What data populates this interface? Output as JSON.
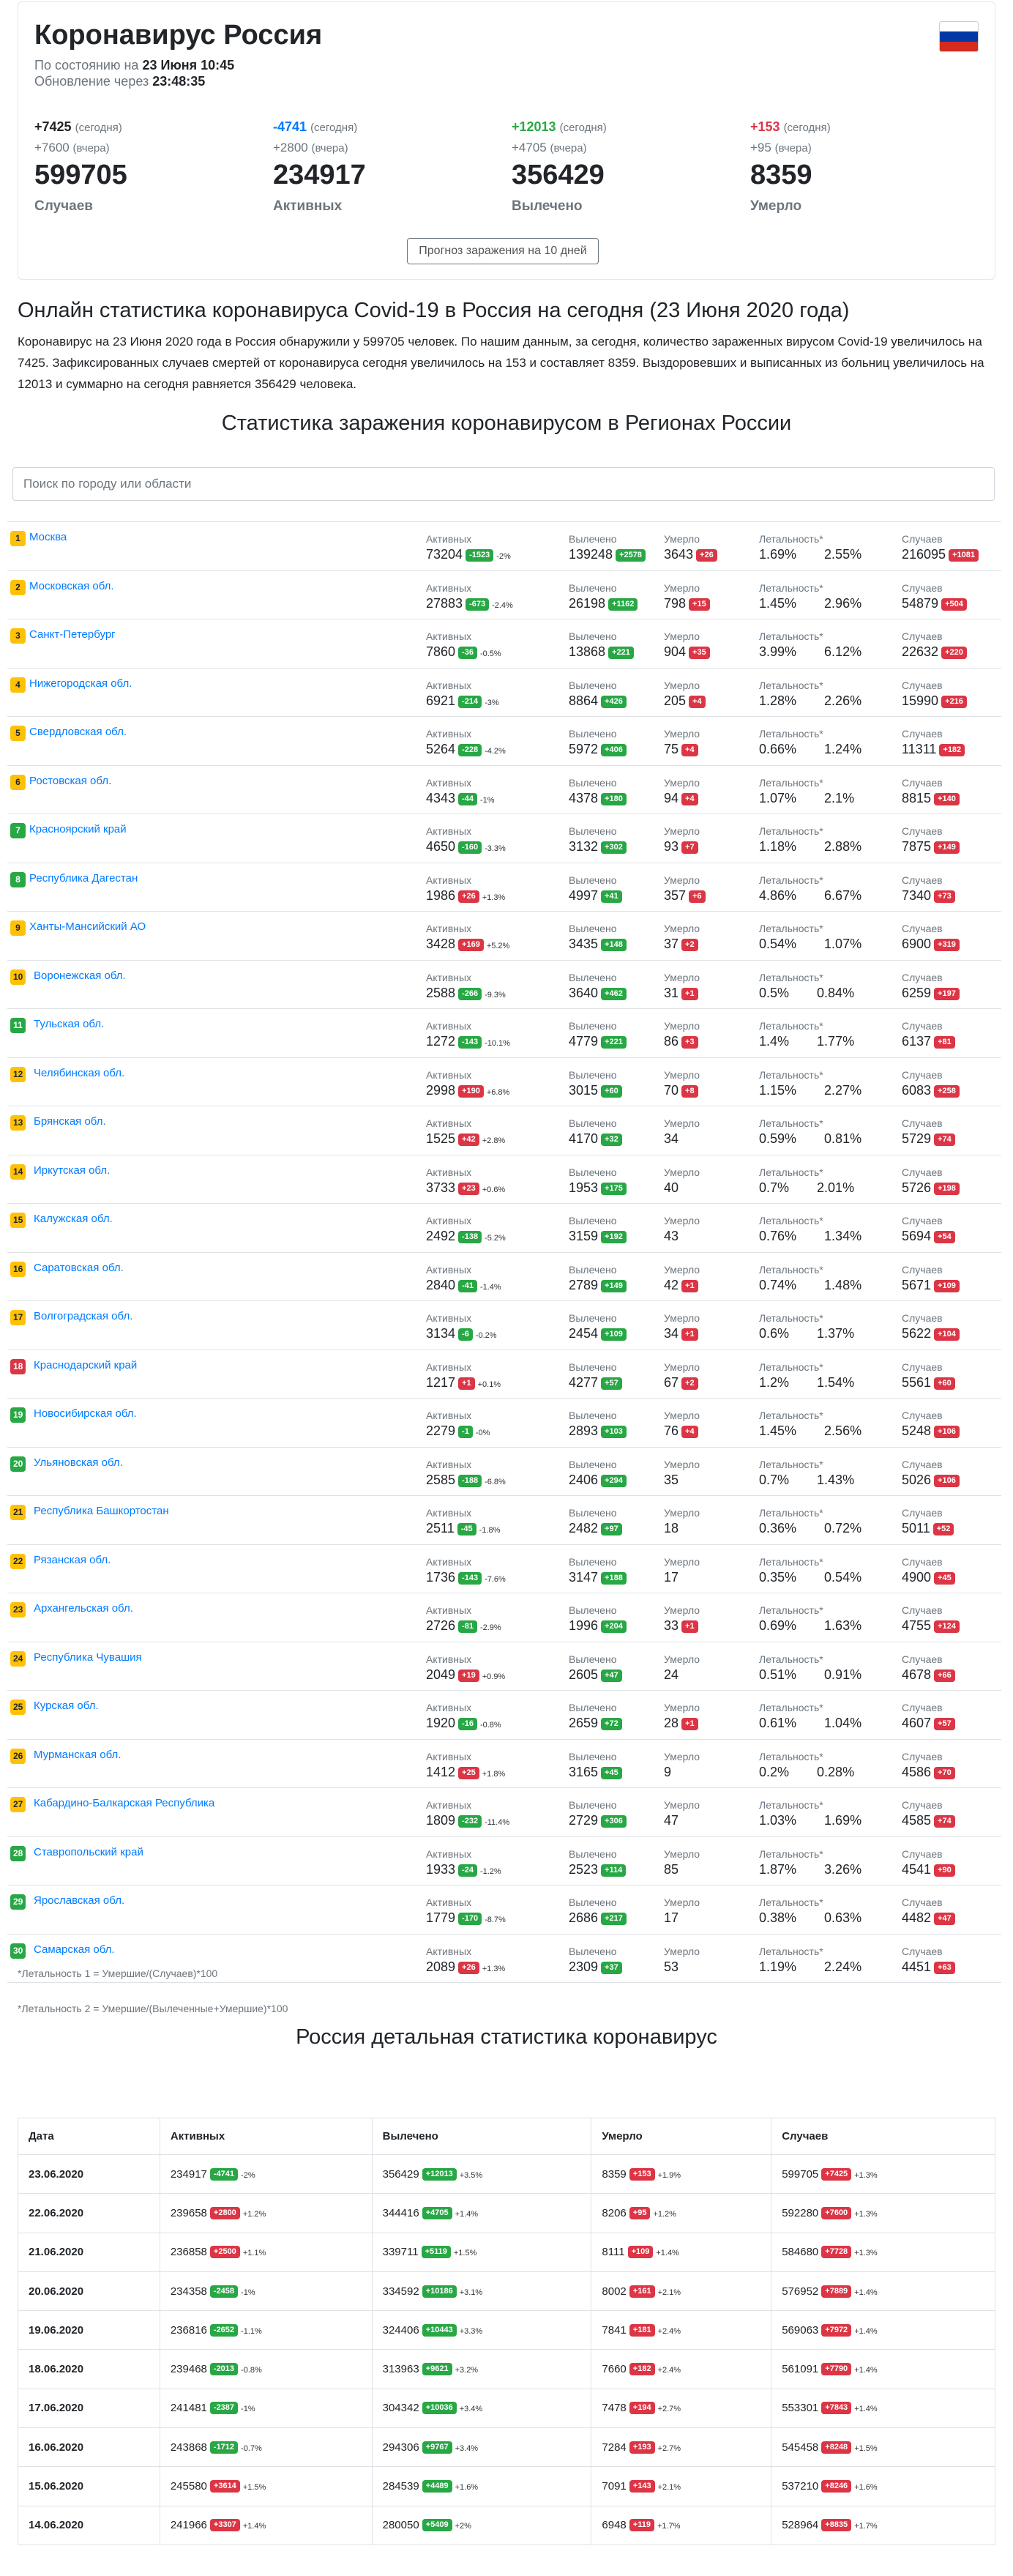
{
  "header": {
    "title": "Коронавирус Россия",
    "as_of_label": "По состоянию на",
    "as_of_value": "23 Июня 10:45",
    "update_label": "Обновление через",
    "update_value": "23:48:35",
    "forecast_button": "Прогноз заражения на 10 дней"
  },
  "flag": {
    "colors": [
      "#ffffff",
      "#0039a6",
      "#d52b1e"
    ]
  },
  "stats": [
    {
      "today": "+7425",
      "today_label": "(сегодня)",
      "yesterday": "+7600",
      "yesterday_label": "(вчера)",
      "value": "599705",
      "label": "Случаев",
      "color": "#212529"
    },
    {
      "today": "-4741",
      "today_label": "(сегодня)",
      "yesterday": "+2800",
      "yesterday_label": "(вчера)",
      "value": "234917",
      "label": "Активных",
      "color": "#007bff"
    },
    {
      "today": "+12013",
      "today_label": "(сегодня)",
      "yesterday": "+4705",
      "yesterday_label": "(вчера)",
      "value": "356429",
      "label": "Вылечено",
      "color": "#28a745"
    },
    {
      "today": "+153",
      "today_label": "(сегодня)",
      "yesterday": "+95",
      "yesterday_label": "(вчера)",
      "value": "8359",
      "label": "Умерло",
      "color": "#dc3545"
    }
  ],
  "article": {
    "title": "Онлайн статистика коронавируса Covid-19 в Россия на сегодня (23 Июня 2020 года)",
    "text": "Коронавирус на 23 Июня 2020 года в Россия обнаружили у 599705 человек. По нашим данным, за сегодня, количество зараженных вирусом Covid-19 увеличилось на 7425. Зафиксированных случаев смертей от коронавируса сегодня увеличилось на 153 и составляет 8359. Выздоровевших и выписанных из больниц увеличилось на 12013 и суммарно на сегодня равняется 356429 человека."
  },
  "regions_title": "Статистика заражения коронавирусом в Регионах России",
  "search": {
    "placeholder": "Поиск по городу или области"
  },
  "col_labels": {
    "active": "Активных",
    "recovered": "Вылечено",
    "deaths": "Умерло",
    "lethality": "Летальность*",
    "cases": "Случаев"
  },
  "regions": [
    {
      "n": "1",
      "name": "Москва",
      "active": "73204",
      "active_d": "-1523",
      "active_pct": "-2%",
      "rec": "139248",
      "rec_d": "+2578",
      "death": "3643",
      "death_d": "+26",
      "let1": "1.69%",
      "let2": "2.55%",
      "cases": "216095",
      "cases_d": "+1081"
    },
    {
      "n": "2",
      "name": "Московская обл.",
      "active": "27883",
      "active_d": "-673",
      "active_pct": "-2.4%",
      "rec": "26198",
      "rec_d": "+1162",
      "death": "798",
      "death_d": "+15",
      "let1": "1.45%",
      "let2": "2.96%",
      "cases": "54879",
      "cases_d": "+504"
    },
    {
      "n": "3",
      "name": "Санкт-Петербург",
      "active": "7860",
      "active_d": "-36",
      "active_pct": "-0.5%",
      "rec": "13868",
      "rec_d": "+221",
      "death": "904",
      "death_d": "+35",
      "let1": "3.99%",
      "let2": "6.12%",
      "cases": "22632",
      "cases_d": "+220"
    },
    {
      "n": "4",
      "name": "Нижегородская обл.",
      "active": "6921",
      "active_d": "-214",
      "active_pct": "-3%",
      "rec": "8864",
      "rec_d": "+426",
      "death": "205",
      "death_d": "+4",
      "let1": "1.28%",
      "let2": "2.26%",
      "cases": "15990",
      "cases_d": "+216"
    },
    {
      "n": "5",
      "name": "Свердловская обл.",
      "active": "5264",
      "active_d": "-228",
      "active_pct": "-4.2%",
      "rec": "5972",
      "rec_d": "+406",
      "death": "75",
      "death_d": "+4",
      "let1": "0.66%",
      "let2": "1.24%",
      "cases": "11311",
      "cases_d": "+182"
    },
    {
      "n": "6",
      "name": "Ростовская обл.",
      "active": "4343",
      "active_d": "-44",
      "active_pct": "-1%",
      "rec": "4378",
      "rec_d": "+180",
      "death": "94",
      "death_d": "+4",
      "let1": "1.07%",
      "let2": "2.1%",
      "cases": "8815",
      "cases_d": "+140"
    },
    {
      "n": "7",
      "name": "Красноярский край",
      "active": "4650",
      "active_d": "-160",
      "active_pct": "-3.3%",
      "rec": "3132",
      "rec_d": "+302",
      "death": "93",
      "death_d": "+7",
      "let1": "1.18%",
      "let2": "2.88%",
      "cases": "7875",
      "cases_d": "+149"
    },
    {
      "n": "8",
      "name": "Республика Дагестан",
      "active": "1986",
      "active_d": "+26",
      "active_pct": "+1.3%",
      "rec": "4997",
      "rec_d": "+41",
      "death": "357",
      "death_d": "+6",
      "let1": "4.86%",
      "let2": "6.67%",
      "cases": "7340",
      "cases_d": "+73"
    },
    {
      "n": "9",
      "name": "Ханты-Мансийский АО",
      "active": "3428",
      "active_d": "+169",
      "active_pct": "+5.2%",
      "rec": "3435",
      "rec_d": "+148",
      "death": "37",
      "death_d": "+2",
      "let1": "0.54%",
      "let2": "1.07%",
      "cases": "6900",
      "cases_d": "+319"
    },
    {
      "n": "10",
      "name": "Воронежская обл.",
      "active": "2588",
      "active_d": "-266",
      "active_pct": "-9.3%",
      "rec": "3640",
      "rec_d": "+462",
      "death": "31",
      "death_d": "+1",
      "let1": "0.5%",
      "let2": "0.84%",
      "cases": "6259",
      "cases_d": "+197"
    },
    {
      "n": "11",
      "name": "Тульская обл.",
      "active": "1272",
      "active_d": "-143",
      "active_pct": "-10.1%",
      "rec": "4779",
      "rec_d": "+221",
      "death": "86",
      "death_d": "+3",
      "let1": "1.4%",
      "let2": "1.77%",
      "cases": "6137",
      "cases_d": "+81"
    },
    {
      "n": "12",
      "name": "Челябинская обл.",
      "active": "2998",
      "active_d": "+190",
      "active_pct": "+6.8%",
      "rec": "3015",
      "rec_d": "+60",
      "death": "70",
      "death_d": "+8",
      "let1": "1.15%",
      "let2": "2.27%",
      "cases": "6083",
      "cases_d": "+258"
    },
    {
      "n": "13",
      "name": "Брянская обл.",
      "active": "1525",
      "active_d": "+42",
      "active_pct": "+2.8%",
      "rec": "4170",
      "rec_d": "+32",
      "death": "34",
      "death_d": "",
      "let1": "0.59%",
      "let2": "0.81%",
      "cases": "5729",
      "cases_d": "+74"
    },
    {
      "n": "14",
      "name": "Иркутская обл.",
      "active": "3733",
      "active_d": "+23",
      "active_pct": "+0.6%",
      "rec": "1953",
      "rec_d": "+175",
      "death": "40",
      "death_d": "",
      "let1": "0.7%",
      "let2": "2.01%",
      "cases": "5726",
      "cases_d": "+198"
    },
    {
      "n": "15",
      "name": "Калужская обл.",
      "active": "2492",
      "active_d": "-138",
      "active_pct": "-5.2%",
      "rec": "3159",
      "rec_d": "+192",
      "death": "43",
      "death_d": "",
      "let1": "0.76%",
      "let2": "1.34%",
      "cases": "5694",
      "cases_d": "+54"
    },
    {
      "n": "16",
      "name": "Саратовская обл.",
      "active": "2840",
      "active_d": "-41",
      "active_pct": "-1.4%",
      "rec": "2789",
      "rec_d": "+149",
      "death": "42",
      "death_d": "+1",
      "let1": "0.74%",
      "let2": "1.48%",
      "cases": "5671",
      "cases_d": "+109"
    },
    {
      "n": "17",
      "name": "Волгоградская обл.",
      "active": "3134",
      "active_d": "-6",
      "active_pct": "-0.2%",
      "rec": "2454",
      "rec_d": "+109",
      "death": "34",
      "death_d": "+1",
      "let1": "0.6%",
      "let2": "1.37%",
      "cases": "5622",
      "cases_d": "+104"
    },
    {
      "n": "18",
      "name": "Краснодарский край",
      "active": "1217",
      "active_d": "+1",
      "active_pct": "+0.1%",
      "rec": "4277",
      "rec_d": "+57",
      "death": "67",
      "death_d": "+2",
      "let1": "1.2%",
      "let2": "1.54%",
      "cases": "5561",
      "cases_d": "+60"
    },
    {
      "n": "19",
      "name": "Новосибирская обл.",
      "active": "2279",
      "active_d": "-1",
      "active_pct": "-0%",
      "rec": "2893",
      "rec_d": "+103",
      "death": "76",
      "death_d": "+4",
      "let1": "1.45%",
      "let2": "2.56%",
      "cases": "5248",
      "cases_d": "+106"
    },
    {
      "n": "20",
      "name": "Ульяновская обл.",
      "active": "2585",
      "active_d": "-188",
      "active_pct": "-6.8%",
      "rec": "2406",
      "rec_d": "+294",
      "death": "35",
      "death_d": "",
      "let1": "0.7%",
      "let2": "1.43%",
      "cases": "5026",
      "cases_d": "+106"
    },
    {
      "n": "21",
      "name": "Республика Башкортостан",
      "active": "2511",
      "active_d": "-45",
      "active_pct": "-1.8%",
      "rec": "2482",
      "rec_d": "+97",
      "death": "18",
      "death_d": "",
      "let1": "0.36%",
      "let2": "0.72%",
      "cases": "5011",
      "cases_d": "+52"
    },
    {
      "n": "22",
      "name": "Рязанская обл.",
      "active": "1736",
      "active_d": "-143",
      "active_pct": "-7.6%",
      "rec": "3147",
      "rec_d": "+188",
      "death": "17",
      "death_d": "",
      "let1": "0.35%",
      "let2": "0.54%",
      "cases": "4900",
      "cases_d": "+45"
    },
    {
      "n": "23",
      "name": "Архангельская обл.",
      "active": "2726",
      "active_d": "-81",
      "active_pct": "-2.9%",
      "rec": "1996",
      "rec_d": "+204",
      "death": "33",
      "death_d": "+1",
      "let1": "0.69%",
      "let2": "1.63%",
      "cases": "4755",
      "cases_d": "+124"
    },
    {
      "n": "24",
      "name": "Республика Чувашия",
      "active": "2049",
      "active_d": "+19",
      "active_pct": "+0.9%",
      "rec": "2605",
      "rec_d": "+47",
      "death": "24",
      "death_d": "",
      "let1": "0.51%",
      "let2": "0.91%",
      "cases": "4678",
      "cases_d": "+66"
    },
    {
      "n": "25",
      "name": "Курская обл.",
      "active": "1920",
      "active_d": "-16",
      "active_pct": "-0.8%",
      "rec": "2659",
      "rec_d": "+72",
      "death": "28",
      "death_d": "+1",
      "let1": "0.61%",
      "let2": "1.04%",
      "cases": "4607",
      "cases_d": "+57"
    },
    {
      "n": "26",
      "name": "Мурманская обл.",
      "active": "1412",
      "active_d": "+25",
      "active_pct": "+1.8%",
      "rec": "3165",
      "rec_d": "+45",
      "death": "9",
      "death_d": "",
      "let1": "0.2%",
      "let2": "0.28%",
      "cases": "4586",
      "cases_d": "+70"
    },
    {
      "n": "27",
      "name": "Кабардино-Балкарская Республика",
      "active": "1809",
      "active_d": "-232",
      "active_pct": "-11.4%",
      "rec": "2729",
      "rec_d": "+306",
      "death": "47",
      "death_d": "",
      "let1": "1.03%",
      "let2": "1.69%",
      "cases": "4585",
      "cases_d": "+74"
    },
    {
      "n": "28",
      "name": "Ставропольский край",
      "active": "1933",
      "active_d": "-24",
      "active_pct": "-1.2%",
      "rec": "2523",
      "rec_d": "+114",
      "death": "85",
      "death_d": "",
      "let1": "1.87%",
      "let2": "3.26%",
      "cases": "4541",
      "cases_d": "+90"
    },
    {
      "n": "29",
      "name": "Ярославская обл.",
      "active": "1779",
      "active_d": "-170",
      "active_pct": "-8.7%",
      "rec": "2686",
      "rec_d": "+217",
      "death": "17",
      "death_d": "",
      "let1": "0.38%",
      "let2": "0.63%",
      "cases": "4482",
      "cases_d": "+47"
    },
    {
      "n": "30",
      "name": "Самарская обл.",
      "active": "2089",
      "active_d": "+26",
      "active_pct": "+1.3%",
      "rec": "2309",
      "rec_d": "+37",
      "death": "53",
      "death_d": "",
      "let1": "1.19%",
      "let2": "2.24%",
      "cases": "4451",
      "cases_d": "+63"
    }
  ],
  "notes": {
    "n1": "*Летальность 1 = Умершие/(Случаев)*100",
    "n2": "*Летальность 2 = Умершие/(Вылеченные+Умершие)*100"
  },
  "detail": {
    "title": "Россия детальная статистика коронавирус",
    "headers": [
      "Дата",
      "Активных",
      "Вылечено",
      "Умерло",
      "Случаев"
    ],
    "rows": [
      {
        "date": "23.06.2020",
        "active": "234917",
        "active_d": "-4741",
        "active_p": "-2%",
        "rec": "356429",
        "rec_d": "+12013",
        "rec_p": "+3.5%",
        "death": "8359",
        "death_d": "+153",
        "death_p": "+1.9%",
        "cases": "599705",
        "cases_d": "+7425",
        "cases_p": "+1.3%"
      },
      {
        "date": "22.06.2020",
        "active": "239658",
        "active_d": "+2800",
        "active_p": "+1.2%",
        "rec": "344416",
        "rec_d": "+4705",
        "rec_p": "+1.4%",
        "death": "8206",
        "death_d": "+95",
        "death_p": "+1.2%",
        "cases": "592280",
        "cases_d": "+7600",
        "cases_p": "+1.3%"
      },
      {
        "date": "21.06.2020",
        "active": "236858",
        "active_d": "+2500",
        "active_p": "+1.1%",
        "rec": "339711",
        "rec_d": "+5119",
        "rec_p": "+1.5%",
        "death": "8111",
        "death_d": "+109",
        "death_p": "+1.4%",
        "cases": "584680",
        "cases_d": "+7728",
        "cases_p": "+1.3%"
      },
      {
        "date": "20.06.2020",
        "active": "234358",
        "active_d": "-2458",
        "active_p": "-1%",
        "rec": "334592",
        "rec_d": "+10186",
        "rec_p": "+3.1%",
        "death": "8002",
        "death_d": "+161",
        "death_p": "+2.1%",
        "cases": "576952",
        "cases_d": "+7889",
        "cases_p": "+1.4%"
      },
      {
        "date": "19.06.2020",
        "active": "236816",
        "active_d": "-2652",
        "active_p": "-1.1%",
        "rec": "324406",
        "rec_d": "+10443",
        "rec_p": "+3.3%",
        "death": "7841",
        "death_d": "+181",
        "death_p": "+2.4%",
        "cases": "569063",
        "cases_d": "+7972",
        "cases_p": "+1.4%"
      },
      {
        "date": "18.06.2020",
        "active": "239468",
        "active_d": "-2013",
        "active_p": "-0.8%",
        "rec": "313963",
        "rec_d": "+9621",
        "rec_p": "+3.2%",
        "death": "7660",
        "death_d": "+182",
        "death_p": "+2.4%",
        "cases": "561091",
        "cases_d": "+7790",
        "cases_p": "+1.4%"
      },
      {
        "date": "17.06.2020",
        "active": "241481",
        "active_d": "-2387",
        "active_p": "-1%",
        "rec": "304342",
        "rec_d": "+10036",
        "rec_p": "+3.4%",
        "death": "7478",
        "death_d": "+194",
        "death_p": "+2.7%",
        "cases": "553301",
        "cases_d": "+7843",
        "cases_p": "+1.4%"
      },
      {
        "date": "16.06.2020",
        "active": "243868",
        "active_d": "-1712",
        "active_p": "-0.7%",
        "rec": "294306",
        "rec_d": "+9767",
        "rec_p": "+3.4%",
        "death": "7284",
        "death_d": "+193",
        "death_p": "+2.7%",
        "cases": "545458",
        "cases_d": "+8248",
        "cases_p": "+1.5%"
      },
      {
        "date": "15.06.2020",
        "active": "245580",
        "active_d": "+3614",
        "active_p": "+1.5%",
        "rec": "284539",
        "rec_d": "+4489",
        "rec_p": "+1.6%",
        "death": "7091",
        "death_d": "+143",
        "death_p": "+2.1%",
        "cases": "537210",
        "cases_d": "+8246",
        "cases_p": "+1.6%"
      },
      {
        "date": "14.06.2020",
        "active": "241966",
        "active_d": "+3307",
        "active_p": "+1.4%",
        "rec": "280050",
        "rec_d": "+5409",
        "rec_p": "+2%",
        "death": "6948",
        "death_d": "+119",
        "death_p": "+1.7%",
        "cases": "528964",
        "cases_d": "+8835",
        "cases_p": "+1.7%"
      }
    ]
  },
  "colors": {
    "green": "#28a745",
    "red": "#dc3545",
    "yellow": "#ffc107",
    "blue": "#007bff"
  }
}
